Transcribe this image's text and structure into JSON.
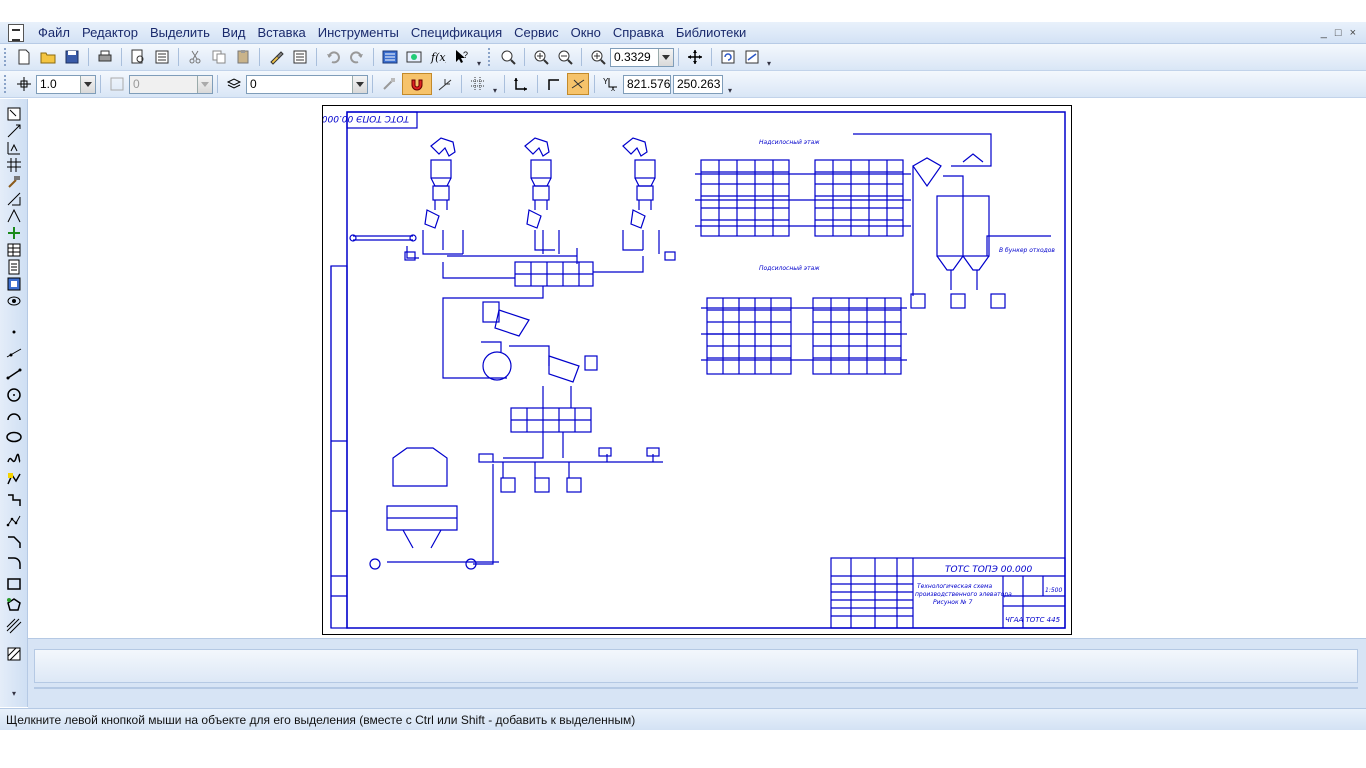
{
  "menu": {
    "items": [
      "Файл",
      "Редактор",
      "Выделить",
      "Вид",
      "Вставка",
      "Инструменты",
      "Спецификация",
      "Сервис",
      "Окно",
      "Справка",
      "Библиотеки"
    ],
    "window_controls": [
      "_",
      "□",
      "×"
    ]
  },
  "toolbar1": {
    "zoom_value": "0.3329"
  },
  "toolbar2": {
    "step_value": "1.0",
    "angle_value": "0",
    "layer_value": "0",
    "coord_x": "821.576",
    "coord_y": "250.263"
  },
  "drawing": {
    "stamp_top_left": "ТОТС ТОПЭ 00.000",
    "title_code": "ТОТС ТОПЭ 00.000",
    "title_text_1": "Технологическая схема",
    "title_text_2": "производственного элеватора",
    "title_text_3": "Рисунок № 7",
    "org": "ЧГАА ТОТС 445",
    "scale": "1:500",
    "label_upper_floor": "Надсилосный этаж",
    "label_lower_floor": "Подсилосный этаж",
    "label_aspiration": "В бункер отходов"
  },
  "status": {
    "message": "Щелкните левой кнопкой мыши на объекте для его выделения (вместе с Ctrl или Shift - добавить к выделенным)"
  },
  "colors": {
    "drawing_line": "#0000cc",
    "frame": "#000000"
  }
}
